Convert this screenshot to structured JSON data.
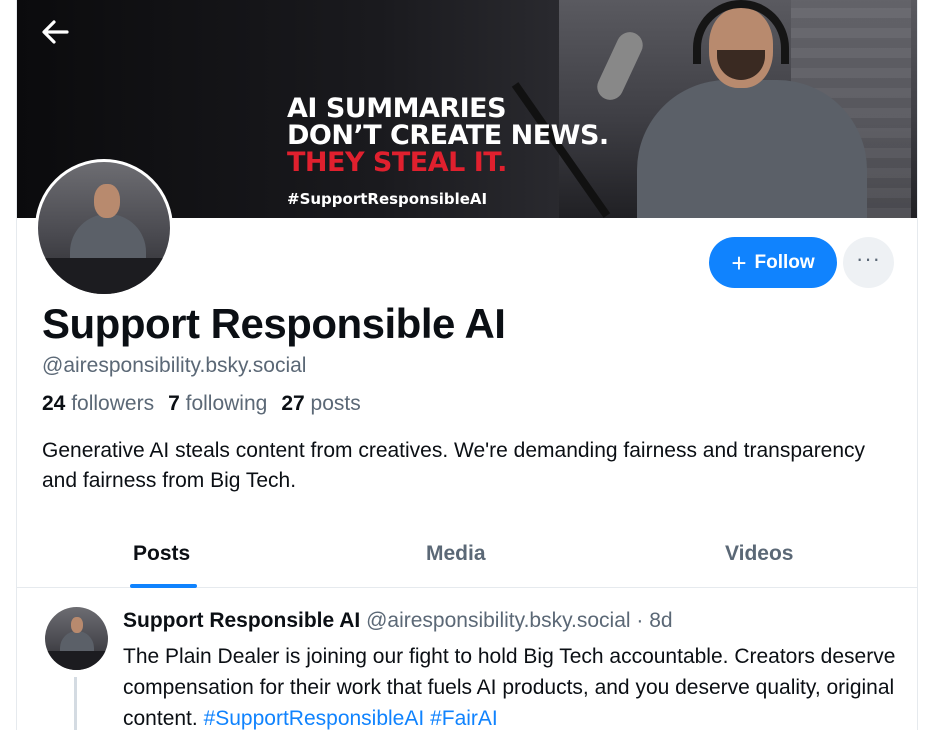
{
  "banner": {
    "headline_line1": "AI SUMMARIES",
    "headline_line2": "DON’T CREATE NEWS.",
    "headline_line3": "THEY STEAL IT.",
    "hashtag": "#SupportResponsibleAI"
  },
  "profile": {
    "display_name": "Support Responsible AI",
    "handle": "@airesponsibility.bsky.social",
    "followers_count": "24",
    "followers_label": "followers",
    "following_count": "7",
    "following_label": "following",
    "posts_count": "27",
    "posts_label": "posts",
    "bio": "Generative AI steals content from creatives. We're demanding fairness and transparency and fairness from Big Tech."
  },
  "actions": {
    "follow_label": "Follow",
    "more_label": "···"
  },
  "tabs": [
    {
      "label": "Posts",
      "active": true
    },
    {
      "label": "Media",
      "active": false
    },
    {
      "label": "Videos",
      "active": false
    }
  ],
  "post": {
    "author": "Support Responsible AI",
    "handle": "@airesponsibility.bsky.social",
    "separator": " · ",
    "time": "8d",
    "text": "The Plain Dealer is joining our fight to hold Big Tech accountable. Creators deserve compensation for their work that fuels AI products, and you deserve quality, original content. ",
    "hashtag1": "#SupportResponsibleAI",
    "hashtag2": "#FairAI"
  },
  "icons": {
    "back": "arrow-left-icon",
    "follow": "plus-icon",
    "more": "ellipsis-icon"
  },
  "colors": {
    "accent": "#1083fe",
    "banner_red": "#e0202e",
    "muted_text": "#5b6876"
  }
}
